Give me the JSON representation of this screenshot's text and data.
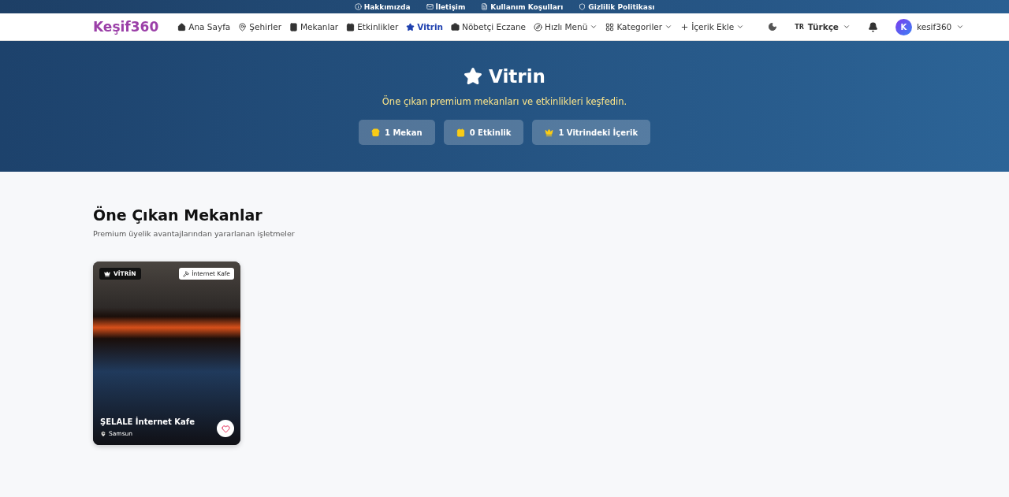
{
  "top_links": [
    "Hakkımızda",
    "İletişim",
    "Kullanım Koşulları",
    "Gizlilik Politikası"
  ],
  "navbar": {
    "logo": "Keşif360",
    "items": [
      {
        "label": "Ana Sayfa",
        "kind": "link",
        "selected": false
      },
      {
        "label": "Şehirler",
        "kind": "link",
        "selected": false
      },
      {
        "label": "Mekanlar",
        "kind": "link",
        "selected": false
      },
      {
        "label": "Etkinlikler",
        "kind": "link",
        "selected": false
      },
      {
        "label": "Vitrin",
        "kind": "link",
        "selected": true
      },
      {
        "label": "Nöbetçi Eczane",
        "kind": "link",
        "selected": false
      },
      {
        "label": "Hızlı Menü",
        "kind": "dropdown",
        "selected": false
      },
      {
        "label": "Kategoriler",
        "kind": "dropdown",
        "selected": false
      },
      {
        "label": "İçerik Ekle",
        "kind": "dropdown",
        "selected": false
      }
    ],
    "language_code": "TR",
    "language": "Türkçe",
    "avatar_letter": "K",
    "username": "kesif360"
  },
  "hero": {
    "title": "Vitrin",
    "subtitle": "Öne çıkan premium mekanları ve etkinlikleri keşfedin.",
    "stats": [
      "1 Mekan",
      "0 Etkinlik",
      "1 Vitrindeki İçerik"
    ]
  },
  "section": {
    "title": "Öne Çıkan Mekanlar",
    "subtitle": "Premium üyelik avantajlarından yararlanan işletmeler",
    "cards": [
      {
        "badge": "VİTRİN",
        "category": "İnternet Kafe",
        "name": "ŞELALE İnternet Kafe",
        "city": "Samsun",
        "favorited": false
      }
    ]
  }
}
